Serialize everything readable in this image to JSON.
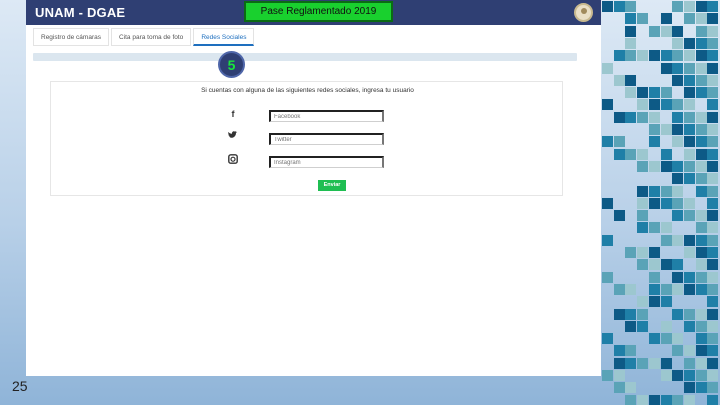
{
  "slide": {
    "page_number": "25"
  },
  "overlay": {
    "label": "Pase Reglamentado 2019"
  },
  "app": {
    "brand": "UNAM - DGAE",
    "tabs": [
      {
        "label": "Registro de cámaras",
        "active": false
      },
      {
        "label": "Cita para toma de foto",
        "active": false
      },
      {
        "label": "Redes Sociales",
        "active": true
      }
    ],
    "step_badge": "5",
    "panel_title": "Si cuentas con alguna de las siguientes redes sociales, ingresa tu usuario",
    "fields": [
      {
        "icon": "facebook-icon",
        "placeholder": "Facebook"
      },
      {
        "icon": "twitter-icon",
        "placeholder": "Twitter"
      },
      {
        "icon": "instagram-icon",
        "placeholder": "Instagram"
      }
    ],
    "submit_label": "Enviar"
  },
  "colors": {
    "navbar": "#2f3f73",
    "accent_tab": "#1e6fbf",
    "submit": "#1fbe52",
    "overlay": "#19d02e",
    "badge_text": "#18e63c"
  }
}
